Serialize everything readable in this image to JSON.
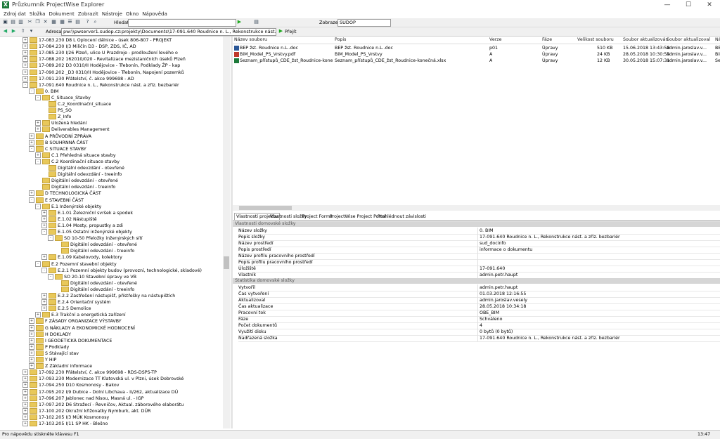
{
  "window": {
    "title": "Průzkumník ProjectWise Explorer",
    "min_icon": "minimize-icon",
    "max_icon": "maximize-icon",
    "close_icon": "close-icon"
  },
  "menu": [
    "Zdroj dat",
    "Složka",
    "Dokument",
    "Zobrazit",
    "Nástroje",
    "Okno",
    "Nápověda"
  ],
  "toolbar": {
    "search_label": "Hledat:",
    "display_label": "Zobrazení:",
    "display_value": "SUDOP",
    "address_label": "Adresa",
    "address_value": "pw:\\\\pwserver1.sudop.cz:projekty\\Documents\\17-091.640 Roudnice n. L., Rekonstrukce nást. a zříz. bezbariér",
    "go_label": "Přejít"
  },
  "tree": [
    {
      "indent": 0,
      "exp": "+",
      "text": "17-083.230 D8 L Oplocení dálnice - úsek 806-807 - PROJEKT"
    },
    {
      "indent": 0,
      "exp": "+",
      "text": "17-084.230 I/3 Miličín D3 - DSP, ZDS, IČ, AD"
    },
    {
      "indent": 0,
      "exp": "+",
      "text": "17-085.230 I/26 Plzeň, ulice U Prazdroje - prodloužení levého o"
    },
    {
      "indent": 0,
      "exp": "+",
      "text": "17-088.202 162010/020 - Revitalizace mezistaničních úseků Plzeň"
    },
    {
      "indent": 0,
      "exp": "+",
      "text": "17-089.202 D3 0310/II Hodějovice - Třebonín, Podklady ŽP - kap"
    },
    {
      "indent": 0,
      "exp": "+",
      "text": "17-090.202 _D3 0310/II Hodějovice - Třebonín, Napojení pozemků"
    },
    {
      "indent": 0,
      "exp": "+",
      "text": "17-091.230 Přátelství, č. akce 999698 - AD"
    },
    {
      "indent": 0,
      "exp": "-",
      "text": "17-091.640 Roudnice n. L., Rekonstrukce nást. a zříz. bezbariér"
    },
    {
      "indent": 1,
      "exp": "-",
      "text": "0. BIM"
    },
    {
      "indent": 2,
      "exp": "-",
      "text": "C_Situace_Stavby"
    },
    {
      "indent": 3,
      "exp": "",
      "text": "C.2_Koordinační_situace"
    },
    {
      "indent": 3,
      "exp": "",
      "text": "PS_SO"
    },
    {
      "indent": 3,
      "exp": "",
      "text": "Z_Info"
    },
    {
      "indent": 2,
      "exp": "+",
      "text": "Uložená hledání"
    },
    {
      "indent": 2,
      "exp": "+",
      "text": "Deliverables Management"
    },
    {
      "indent": 1,
      "exp": "+",
      "text": "A PRŮVODNÍ ZPRÁVA"
    },
    {
      "indent": 1,
      "exp": "+",
      "text": "B SOUHRNNÁ ČÁST"
    },
    {
      "indent": 1,
      "exp": "-",
      "text": "C SITUACE STAVBY"
    },
    {
      "indent": 2,
      "exp": "+",
      "text": "C.1 Přehledná situace stavby"
    },
    {
      "indent": 2,
      "exp": "-",
      "text": "C.2 Koordinační situace stavby"
    },
    {
      "indent": 3,
      "exp": "",
      "text": "Digitální odevzdání - otevřené"
    },
    {
      "indent": 3,
      "exp": "",
      "text": "Digitální odevzdání - treeinfo"
    },
    {
      "indent": 2,
      "exp": "",
      "text": "Digitální odevzdání - otevřené"
    },
    {
      "indent": 2,
      "exp": "",
      "text": "Digitální odevzdání - treeinfo"
    },
    {
      "indent": 1,
      "exp": "+",
      "text": "D TECHNOLOGICKÁ ČÁST"
    },
    {
      "indent": 1,
      "exp": "-",
      "text": "E STAVEBNÍ ČÁST"
    },
    {
      "indent": 2,
      "exp": "-",
      "text": "E.1 Inženýrské objekty"
    },
    {
      "indent": 3,
      "exp": "+",
      "text": "E.1.01 Železniční svršek a spodek"
    },
    {
      "indent": 3,
      "exp": "+",
      "text": "E.1.02 Nástupiště"
    },
    {
      "indent": 3,
      "exp": "+",
      "text": "E.1.04 Mosty, propustky a zdi"
    },
    {
      "indent": 3,
      "exp": "-",
      "text": "E.1.05 Ostatní inženýrské objekty"
    },
    {
      "indent": 4,
      "exp": "-",
      "text": "SO 10-50 Přeložky inženýrských sítí"
    },
    {
      "indent": 5,
      "exp": "",
      "text": "Digitální odevzdání - otevřené"
    },
    {
      "indent": 5,
      "exp": "",
      "text": "Digitální odevzdání - treeinfo"
    },
    {
      "indent": 3,
      "exp": "+",
      "text": "E.1.09 Kabelovody, kolektory"
    },
    {
      "indent": 2,
      "exp": "-",
      "text": "E.2 Pozemní stavební objekty"
    },
    {
      "indent": 3,
      "exp": "-",
      "text": "E.2.1 Pozemní objekty budov (provozní, technologické, skladové)"
    },
    {
      "indent": 4,
      "exp": "-",
      "text": "SO 20-10 Stavební úpravy ve VB"
    },
    {
      "indent": 5,
      "exp": "",
      "text": "Digitální odevzdání - otevřené"
    },
    {
      "indent": 5,
      "exp": "",
      "text": "Digitální odevzdání - treeinfo"
    },
    {
      "indent": 3,
      "exp": "+",
      "text": "E.2.2 Zastřešení nástupišť, přístřešky na nástupištích"
    },
    {
      "indent": 3,
      "exp": "+",
      "text": "E.2.4 Orientační systém"
    },
    {
      "indent": 3,
      "exp": "+",
      "text": "E.2.5 Demolice"
    },
    {
      "indent": 2,
      "exp": "+",
      "text": "E.3 Trakční a energetická zařízení"
    },
    {
      "indent": 1,
      "exp": "+",
      "text": "F ZÁSADY ORGANIZACE VÝSTAVBY"
    },
    {
      "indent": 1,
      "exp": "+",
      "text": "G NÁKLADY A EKONOMICKÉ HODNOCENÍ"
    },
    {
      "indent": 1,
      "exp": "+",
      "text": "H DOKLADY"
    },
    {
      "indent": 1,
      "exp": "+",
      "text": "I GEODETICKÁ DOKUMENTACE"
    },
    {
      "indent": 1,
      "exp": "+",
      "text": "P Podklady"
    },
    {
      "indent": 1,
      "exp": "+",
      "text": "S Stávající stav"
    },
    {
      "indent": 1,
      "exp": "+",
      "text": "Y HIP"
    },
    {
      "indent": 1,
      "exp": "+",
      "text": "Z Základní informace"
    },
    {
      "indent": 0,
      "exp": "+",
      "text": "17-092.230 Přátelství, č. akce 999698 - RDS-DSPS-TP"
    },
    {
      "indent": 0,
      "exp": "+",
      "text": "17-093.230 Modernizace TT Klatovská ul. v Plzni, úsek Dobrovské"
    },
    {
      "indent": 0,
      "exp": "+",
      "text": "17-094.250 D10 Kosmonosy - Bakov"
    },
    {
      "indent": 0,
      "exp": "+",
      "text": "17-095.202 I/9 Dubice - Dolní Libchava - II/262, aktualizace DÚ"
    },
    {
      "indent": 0,
      "exp": "+",
      "text": "17-096.207 Jablonec nad Nisou, Masná ul. - IGP"
    },
    {
      "indent": 0,
      "exp": "+",
      "text": "17-097.202 D6 Stražecí - Řevničov, Aktual. záborového elaborátu"
    },
    {
      "indent": 0,
      "exp": "+",
      "text": "17-100.202 Okružní křižovatky Nymburk, akt. DÚR"
    },
    {
      "indent": 0,
      "exp": "+",
      "text": "17-102.205 I/3 MÚK Kosmonosy"
    },
    {
      "indent": 0,
      "exp": "+",
      "text": "17-103.205 I/11 SP HK - Blešno"
    }
  ],
  "list": {
    "headers": [
      "Název souboru",
      "Popis",
      "Verze",
      "Fáze",
      "Velikost souboru",
      "Soubor aktualizován",
      "Soubor aktualizoval",
      "Název"
    ],
    "rows": [
      {
        "icon": "word-doc-icon",
        "name": "BEP žst. Roudnice n.L..doc",
        "desc": "BEP žst. Roudnice n.L..doc",
        "ver": "p01",
        "phase": "Úpravy",
        "size": "510 KB",
        "date": "15.06.2018 13:43:58",
        "user": "admin.jaroslav.v...",
        "title": "BEP"
      },
      {
        "icon": "pdf-icon",
        "name": "BiM_Model_PS_Vrstvy.pdf",
        "desc": "BiM_Model_PS_Vrstvy",
        "ver": "A",
        "phase": "Úpravy",
        "size": "24 KB",
        "date": "28.05.2018 10:30:55",
        "user": "admin.jaroslav.v...",
        "title": "BiM"
      },
      {
        "icon": "excel-icon",
        "name": "Seznam_přístupů_CDE_žst_Roudnice-koneč...",
        "desc": "Seznam_přístupů_CDE_žst_Roudnice-konečná.xlsx",
        "ver": "A",
        "phase": "Úpravy",
        "size": "12 KB",
        "date": "30.05.2018 15:07:31",
        "user": "admin.jaroslav.v...",
        "title": "Sez"
      }
    ]
  },
  "tabs": [
    "Vlastnosti projektu",
    "Vlastnosti složky",
    "Project Forms",
    "ProjectWise Project Portal",
    "Prohlédnout závislosti"
  ],
  "props": {
    "section1": "Vlastnosti domovské složky",
    "rows1": [
      {
        "k": "Název složky",
        "v": "0. BIM"
      },
      {
        "k": "Popis složky",
        "v": "17-091.640 Roudnice n. L., Rekonstrukce nást. a zříz. bezbariér"
      },
      {
        "k": "Název prostředí",
        "v": "sud_docinfo"
      },
      {
        "k": "Popis prostředí",
        "v": "informace o dokumentu"
      },
      {
        "k": "Název profilu pracovního prostředí",
        "v": ""
      },
      {
        "k": "Popis profilu pracovního prostředí",
        "v": ""
      },
      {
        "k": "Úložiště",
        "v": "17-091.640"
      },
      {
        "k": "Vlastník",
        "v": "admin.petr.haupt"
      }
    ],
    "section2": "Statistika domovské složky",
    "rows2": [
      {
        "k": "Vytvořil",
        "v": "admin.petr.haupt"
      },
      {
        "k": "Čas vytvoření",
        "v": "01.03.2018 12:16:55"
      },
      {
        "k": "Aktualizoval",
        "v": "admin.jaroslav.vesely"
      },
      {
        "k": "Čas aktualizace",
        "v": "28.05.2018 10:34:18"
      },
      {
        "k": "Pracovní tok",
        "v": "OBE_BIM"
      },
      {
        "k": "Fáze",
        "v": "Schváleno"
      },
      {
        "k": "Počet dokumentů",
        "v": "4"
      },
      {
        "k": "Využití disku",
        "v": "0 bytů (0 bytů)"
      },
      {
        "k": "Nadřazená složka",
        "v": "17-091.640 Roudnice n. L., Rekonstrukce nást. a zříz. bezbariér"
      }
    ]
  },
  "status": {
    "help": "Pro nápovědu stiskněte klávesu F1",
    "clock": "13:47"
  }
}
